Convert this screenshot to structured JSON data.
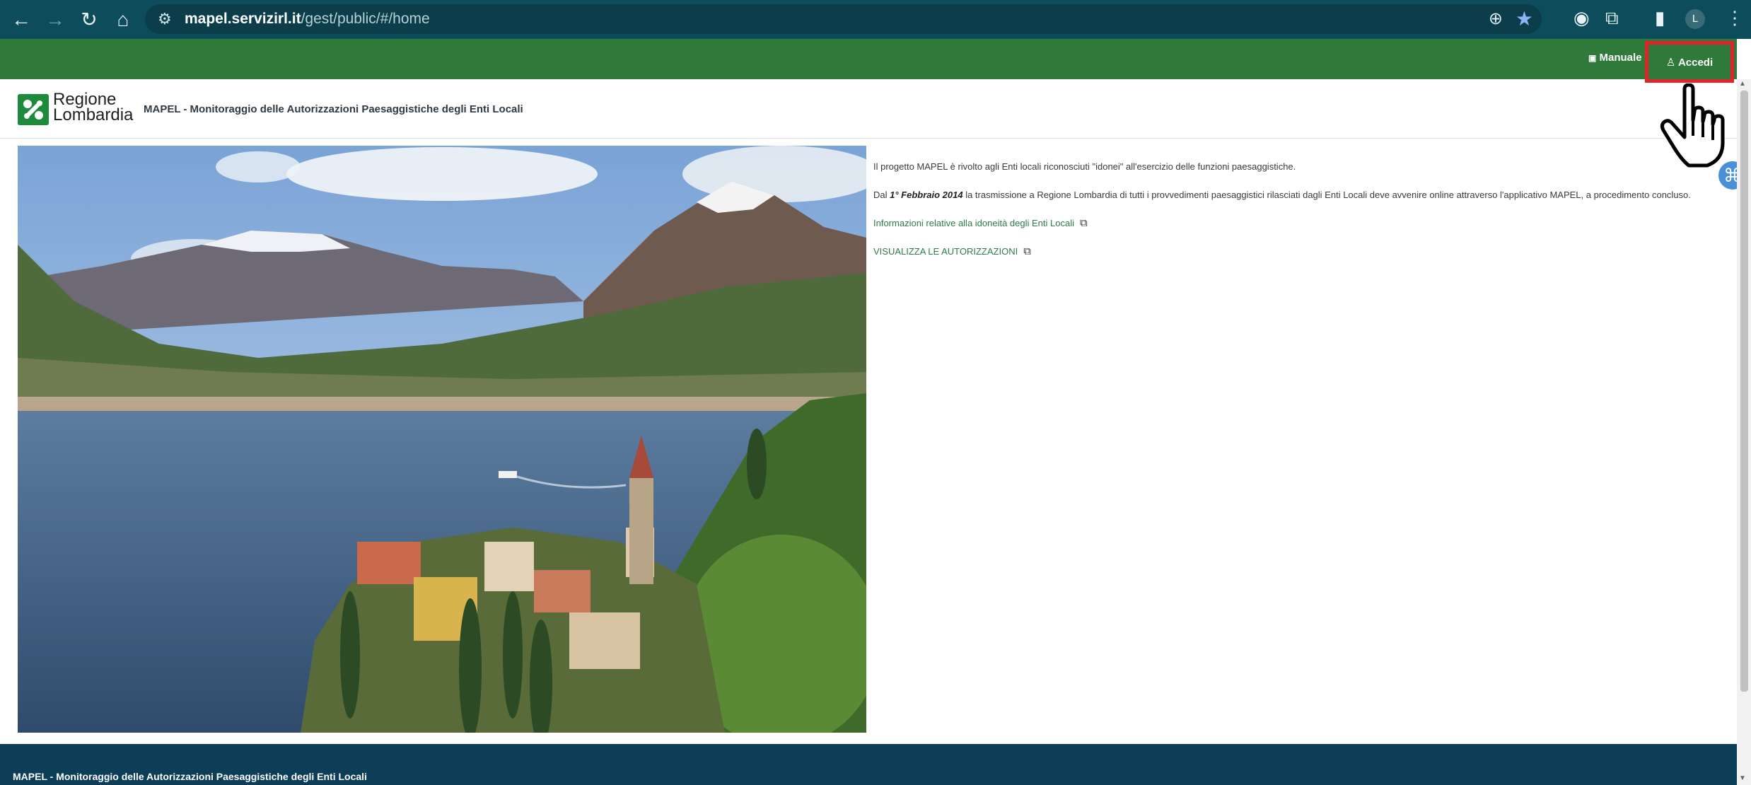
{
  "browser": {
    "url_host": "mapel.servizirl.it",
    "url_path": "/gest/public/#/home",
    "profile_initial": "L"
  },
  "topbar": {
    "manual_label": "Manuale",
    "login_label": "Accedi"
  },
  "header": {
    "logo_line1": "Regione",
    "logo_line2": "Lombardia",
    "app_title": "MAPEL - Monitoraggio delle Autorizzazioni Paesaggistiche degli Enti Locali"
  },
  "content": {
    "intro": "Il progetto MAPEL è rivolto agli Enti locali riconosciuti \"idonei\" all'esercizio delle funzioni paesaggistiche.",
    "date_prefix": "Dal ",
    "date_bold": "1° Febbraio 2014",
    "date_suffix": " la trasmissione a Regione Lombardia di tutti i provvedimenti paesaggistici rilasciati dagli Enti Locali deve avvenire online attraverso l'applicativo MAPEL, a procedimento concluso.",
    "info_link": "Informazioni relative alla idoneità degli Enti Locali",
    "view_link": "VISUALIZZA LE AUTORIZZAZIONI"
  },
  "footer": {
    "title": "MAPEL - Monitoraggio delle Autorizzazioni Paesaggistiche degli Enti Locali"
  },
  "icons": {
    "back": "back-arrow-icon",
    "forward": "forward-arrow-icon",
    "reload": "reload-icon",
    "home": "home-icon",
    "site_info": "tune-icon",
    "zoom": "zoom-icon",
    "bookmark": "star-icon",
    "extensions": "puzzle-icon",
    "menu": "kebab-menu-icon",
    "external": "external-link-icon",
    "user": "user-icon",
    "manual": "document-icon",
    "pointer": "hand-pointer-icon"
  },
  "colors": {
    "chrome": "#0d4d5b",
    "green_bar": "#2f7a3a",
    "highlight": "#e0252a",
    "footer": "#0d3e57",
    "link": "#2d7a4a"
  }
}
